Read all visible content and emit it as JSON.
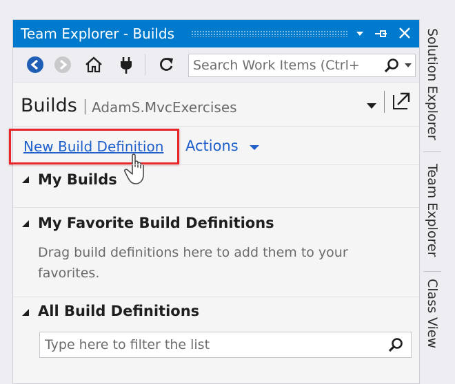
{
  "window": {
    "title": "Team Explorer - Builds",
    "title_buttons": {
      "dropdown": "▾",
      "pin": "⊣",
      "close": "✕"
    }
  },
  "toolbar": {
    "icons": [
      "back-icon",
      "forward-icon",
      "home-icon",
      "connect-icon",
      "refresh-icon"
    ],
    "search_placeholder": "Search Work Items (Ctrl+"
  },
  "header": {
    "title": "Builds",
    "separator": "|",
    "subtitle": "AdamS.MvcExercises"
  },
  "actions": {
    "new_build_definition": "New Build Definition",
    "actions_menu": "Actions"
  },
  "sections": {
    "my_builds": "My Builds",
    "favorites_title": "My Favorite Build Definitions",
    "favorites_text": "Drag build definitions here to add them to your favorites.",
    "all_title": "All Build Definitions",
    "filter_placeholder": "Type here to filter the list"
  },
  "side_tabs": [
    "Solution Explorer",
    "Team Explorer",
    "Class View"
  ],
  "colors": {
    "title_bar": "#007acc",
    "link": "#1e5fcb",
    "highlight_box": "#e8262a"
  }
}
